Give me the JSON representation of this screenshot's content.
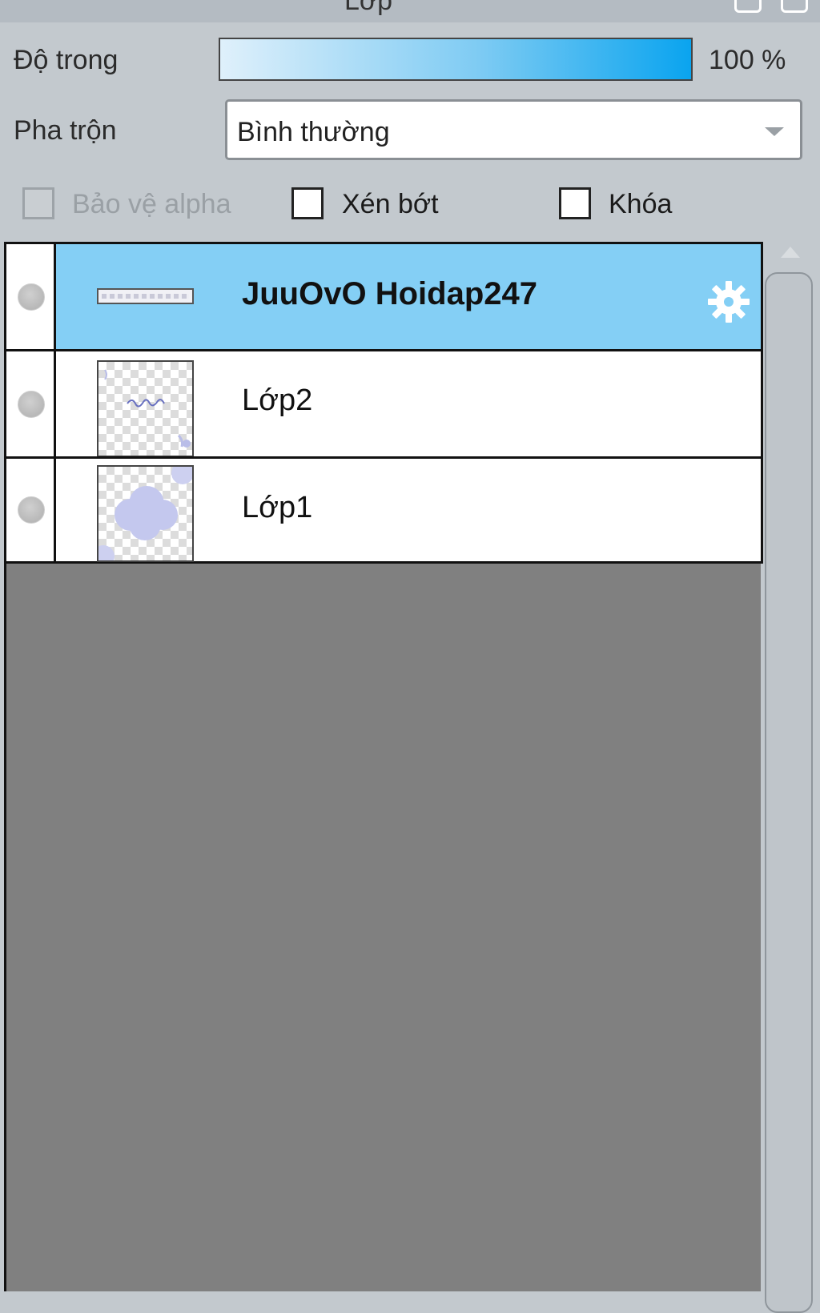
{
  "panel": {
    "title": "Lớp"
  },
  "opacity": {
    "label": "Độ trong",
    "value": "100 %",
    "level_percent": 100
  },
  "blend": {
    "label": "Pha trộn",
    "selected": "Bình thường"
  },
  "options": {
    "alpha_protect": {
      "label": "Bảo vệ alpha",
      "checked": false,
      "enabled": false
    },
    "clip": {
      "label": "Xén bớt",
      "checked": false,
      "enabled": true
    },
    "lock": {
      "label": "Khóa",
      "checked": false,
      "enabled": true
    }
  },
  "layers": [
    {
      "name": "JuuOvO Hoidap247",
      "selected": true,
      "thumbnail": "text-strip",
      "has_effect_icon": true
    },
    {
      "name": "Lớp2",
      "selected": false,
      "thumbnail": "handwritten-sketch",
      "has_effect_icon": false
    },
    {
      "name": "Lớp1",
      "selected": false,
      "thumbnail": "cloud",
      "has_effect_icon": false
    }
  ],
  "colors": {
    "selected_row": "#84cff5",
    "opacity_fill": "#0aa4ef",
    "panel_bg": "#c3c9ce",
    "empty_area": "#808080"
  }
}
